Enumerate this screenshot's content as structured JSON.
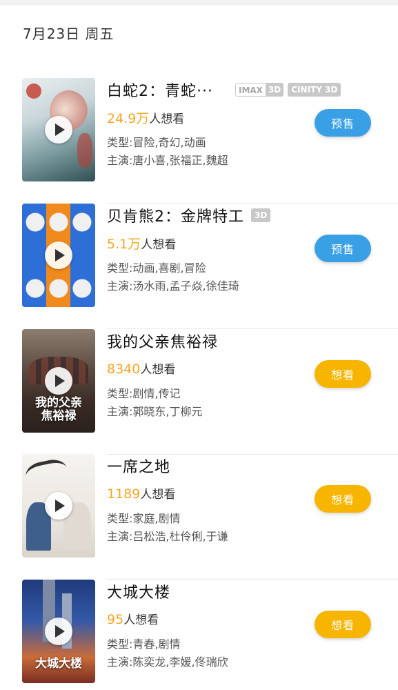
{
  "date_header": "7月23日 周五",
  "movies": [
    {
      "title": "白蛇2：青蛇···",
      "badges": [
        {
          "a": "IMAX",
          "b": "3D"
        },
        {
          "a": "CINITY",
          "b": "3D"
        }
      ],
      "wish_num": "24.9万",
      "wish_suffix": "人想看",
      "genre": "类型:冒险,奇幻,动画",
      "cast": "主演:唐小喜,张福正,魏超",
      "button": "预售",
      "button_color": "#3aa0e6",
      "poster_text": ""
    },
    {
      "title": "贝肯熊2：金牌特工",
      "badge_single": "3D",
      "wish_num": "5.1万",
      "wish_suffix": "人想看",
      "genre": "类型:动画,喜剧,冒险",
      "cast": "主演:汤水雨,孟子焱,徐佳琦",
      "button": "预售",
      "button_color": "#3aa0e6",
      "poster_text": ""
    },
    {
      "title": "我的父亲焦裕禄",
      "wish_num": "8340",
      "wish_suffix": "人想看",
      "genre": "类型:剧情,传记",
      "cast": "主演:郭晓东,丁柳元",
      "button": "想看",
      "button_color": "#f7b500",
      "poster_text": "我的父亲 焦裕禄"
    },
    {
      "title": "一席之地",
      "wish_num": "1189",
      "wish_suffix": "人想看",
      "genre": "类型:家庭,剧情",
      "cast": "主演:吕松浩,杜伶俐,于谦",
      "button": "想看",
      "button_color": "#f7b500",
      "poster_text": ""
    },
    {
      "title": "大城大楼",
      "wish_num": "95",
      "wish_suffix": "人想看",
      "genre": "类型:青春,剧情",
      "cast": "主演:陈奕龙,李媛,佟瑞欣",
      "button": "想看",
      "button_color": "#f7b500",
      "poster_text": "大城大楼"
    }
  ]
}
